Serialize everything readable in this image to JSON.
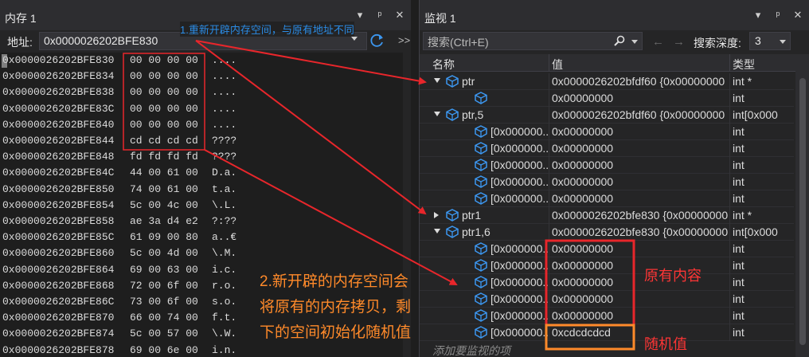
{
  "memory": {
    "title": "内存 1",
    "address_label": "地址:",
    "address_value": "0x0000026202BFE830",
    "more": ">>",
    "rows": [
      {
        "addr": "0x0000026202BFE830",
        "bytes": "00 00 00 00",
        "text": "...."
      },
      {
        "addr": "0x0000026202BFE834",
        "bytes": "00 00 00 00",
        "text": "...."
      },
      {
        "addr": "0x0000026202BFE838",
        "bytes": "00 00 00 00",
        "text": "...."
      },
      {
        "addr": "0x0000026202BFE83C",
        "bytes": "00 00 00 00",
        "text": "...."
      },
      {
        "addr": "0x0000026202BFE840",
        "bytes": "00 00 00 00",
        "text": "...."
      },
      {
        "addr": "0x0000026202BFE844",
        "bytes": "cd cd cd cd",
        "text": "????"
      },
      {
        "addr": "0x0000026202BFE848",
        "bytes": "fd fd fd fd",
        "text": "????"
      },
      {
        "addr": "0x0000026202BFE84C",
        "bytes": "44 00 61 00",
        "text": "D.a."
      },
      {
        "addr": "0x0000026202BFE850",
        "bytes": "74 00 61 00",
        "text": "t.a."
      },
      {
        "addr": "0x0000026202BFE854",
        "bytes": "5c 00 4c 00",
        "text": "\\.L."
      },
      {
        "addr": "0x0000026202BFE858",
        "bytes": "ae 3a d4 e2",
        "text": "?:??"
      },
      {
        "addr": "0x0000026202BFE85C",
        "bytes": "61 09 00 80",
        "text": "a..€"
      },
      {
        "addr": "0x0000026202BFE860",
        "bytes": "5c 00 4d 00",
        "text": "\\.M."
      },
      {
        "addr": "0x0000026202BFE864",
        "bytes": "69 00 63 00",
        "text": "i.c."
      },
      {
        "addr": "0x0000026202BFE868",
        "bytes": "72 00 6f 00",
        "text": "r.o."
      },
      {
        "addr": "0x0000026202BFE86C",
        "bytes": "73 00 6f 00",
        "text": "s.o."
      },
      {
        "addr": "0x0000026202BFE870",
        "bytes": "66 00 74 00",
        "text": "f.t."
      },
      {
        "addr": "0x0000026202BFE874",
        "bytes": "5c 00 57 00",
        "text": "\\.W."
      },
      {
        "addr": "0x0000026202BFE878",
        "bytes": "69 00 6e 00",
        "text": "i.n."
      }
    ]
  },
  "watch": {
    "title": "监视 1",
    "search_placeholder": "搜索(Ctrl+E)",
    "depth_label": "搜索深度:",
    "depth_value": "3",
    "columns": {
      "name": "名称",
      "value": "值",
      "type": "类型"
    },
    "rows": [
      {
        "indent": 0,
        "expander": "open",
        "name": "ptr",
        "value": "0x0000026202bfdf60 {0x00000000",
        "type": "int *"
      },
      {
        "indent": 1,
        "expander": "",
        "name": "",
        "value": "0x00000000",
        "type": "int"
      },
      {
        "indent": 0,
        "expander": "open",
        "name": "ptr,5",
        "value": "0x0000026202bfdf60 {0x00000000",
        "type": "int[0x000"
      },
      {
        "indent": 1,
        "expander": "",
        "name": "[0x000000...",
        "value": "0x00000000",
        "type": "int"
      },
      {
        "indent": 1,
        "expander": "",
        "name": "[0x000000...",
        "value": "0x00000000",
        "type": "int"
      },
      {
        "indent": 1,
        "expander": "",
        "name": "[0x000000...",
        "value": "0x00000000",
        "type": "int"
      },
      {
        "indent": 1,
        "expander": "",
        "name": "[0x000000...",
        "value": "0x00000000",
        "type": "int"
      },
      {
        "indent": 1,
        "expander": "",
        "name": "[0x000000...",
        "value": "0x00000000",
        "type": "int"
      },
      {
        "indent": 0,
        "expander": "closed",
        "name": "ptr1",
        "value": "0x0000026202bfe830 {0x00000000",
        "type": "int *"
      },
      {
        "indent": 0,
        "expander": "open",
        "name": "ptr1,6",
        "value": "0x0000026202bfe830 {0x00000000",
        "type": "int[0x000"
      },
      {
        "indent": 1,
        "expander": "",
        "name": "[0x000000...",
        "value": "0x00000000",
        "type": "int"
      },
      {
        "indent": 1,
        "expander": "",
        "name": "[0x000000...",
        "value": "0x00000000",
        "type": "int"
      },
      {
        "indent": 1,
        "expander": "",
        "name": "[0x000000...",
        "value": "0x00000000",
        "type": "int"
      },
      {
        "indent": 1,
        "expander": "",
        "name": "[0x000000...",
        "value": "0x00000000",
        "type": "int"
      },
      {
        "indent": 1,
        "expander": "",
        "name": "[0x000000...",
        "value": "0x00000000",
        "type": "int"
      },
      {
        "indent": 1,
        "expander": "",
        "name": "[0x000000...",
        "value": "0xcdcdcdcd",
        "type": "int"
      }
    ],
    "add_item": "添加要监视的项"
  },
  "annotations": {
    "note_1": "1.重新开辟内存空间，与原有地址不同",
    "note_2_lines": [
      "2.新开辟的内存空间会",
      "将原有的内存拷贝，剩",
      "下的空间初始化随机值"
    ],
    "original_content": "原有内容",
    "random_value": "随机值"
  },
  "colors": {
    "arrow_red": "#e8262b",
    "box_red": "#e8262b",
    "box_orange": "#ff8a2a",
    "note_blue": "#2b8ce6"
  }
}
